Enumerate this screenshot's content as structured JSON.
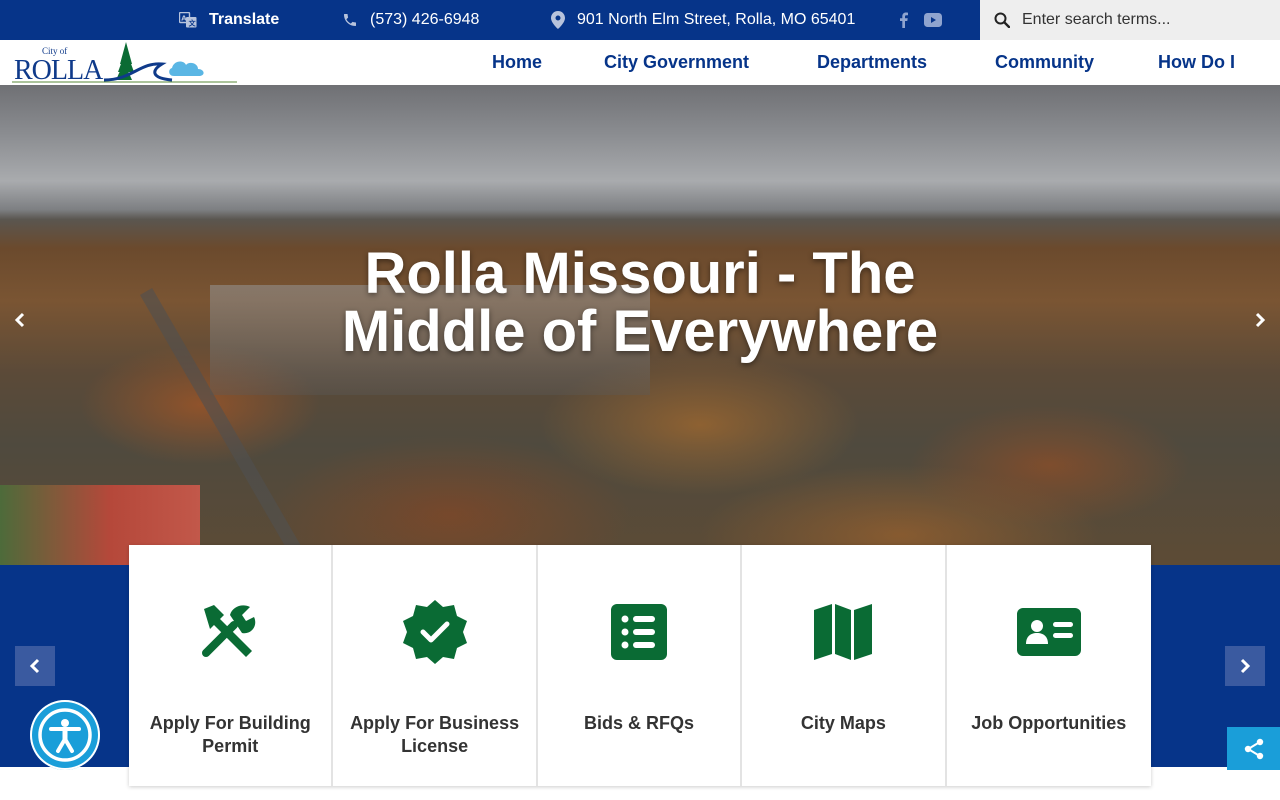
{
  "topbar": {
    "translate_label": "Translate",
    "phone": "(573) 426-6948",
    "address": "901 North Elm Street, Rolla, MO 65401",
    "social_icons": [
      "facebook-icon",
      "youtube-icon"
    ],
    "search_placeholder": "Enter search terms..."
  },
  "logo": {
    "city_of": "City of",
    "name": "ROLLA"
  },
  "nav": {
    "items": [
      {
        "label": "Home"
      },
      {
        "label": "City Government"
      },
      {
        "label": "Departments"
      },
      {
        "label": "Community"
      },
      {
        "label": "How Do I"
      }
    ]
  },
  "hero": {
    "title_line1": "Rolla Missouri - The",
    "title_line2": "Middle of Everywhere"
  },
  "quick_links": [
    {
      "label": "Apply For Building Permit",
      "icon": "tools-icon"
    },
    {
      "label": "Apply For Business License",
      "icon": "badge-check-icon"
    },
    {
      "label": "Bids & RFQs",
      "icon": "list-icon"
    },
    {
      "label": "City Maps",
      "icon": "map-icon"
    },
    {
      "label": "Job Opportunities",
      "icon": "id-card-icon"
    }
  ],
  "colors": {
    "primary_blue": "#063489",
    "icon_green": "#0a6b34",
    "accent_cyan": "#1a9ed9"
  }
}
